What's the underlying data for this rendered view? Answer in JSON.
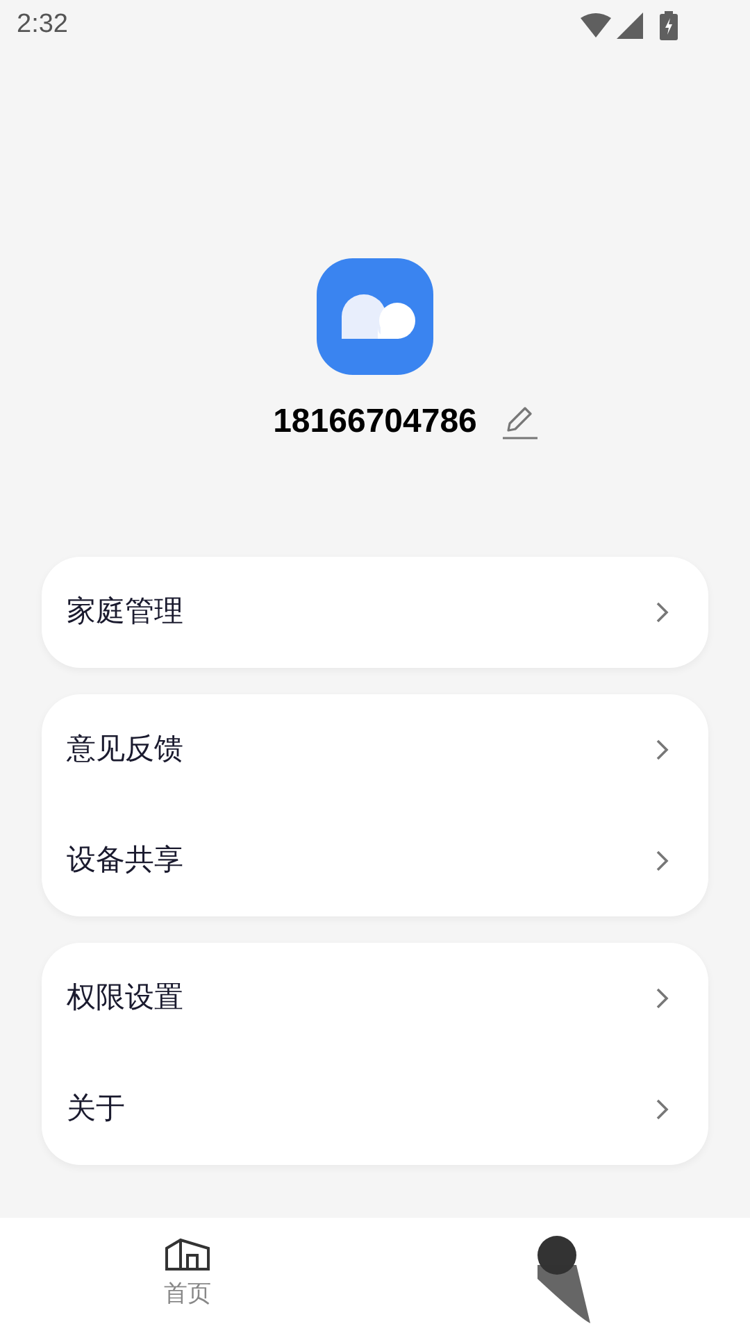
{
  "status_bar": {
    "time": "2:32"
  },
  "profile": {
    "phone": "18166704786"
  },
  "menu_groups": [
    {
      "items": [
        {
          "label": "家庭管理"
        }
      ]
    },
    {
      "items": [
        {
          "label": "意见反馈"
        },
        {
          "label": "设备共享"
        }
      ]
    },
    {
      "items": [
        {
          "label": "权限设置"
        },
        {
          "label": "关于"
        }
      ]
    }
  ],
  "bottom_nav": [
    {
      "label": "首页",
      "selected": false
    },
    {
      "selected": true
    }
  ]
}
